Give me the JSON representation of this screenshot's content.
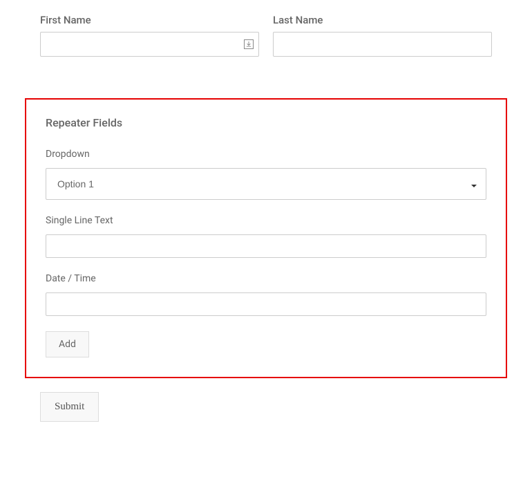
{
  "name_fields": {
    "first_name_label": "First Name",
    "first_name_value": "",
    "last_name_label": "Last Name",
    "last_name_value": ""
  },
  "repeater": {
    "title": "Repeater Fields",
    "dropdown": {
      "label": "Dropdown",
      "selected": "Option 1",
      "options": [
        "Option 1"
      ]
    },
    "single_line": {
      "label": "Single Line Text",
      "value": ""
    },
    "datetime": {
      "label": "Date / Time",
      "value": ""
    },
    "add_label": "Add"
  },
  "submit_label": "Submit"
}
